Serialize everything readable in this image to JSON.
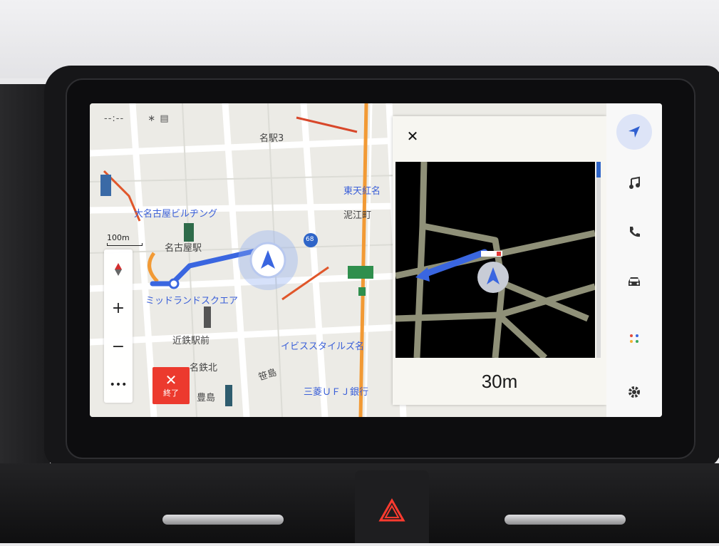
{
  "status": {
    "time": "--:--",
    "indicators": "∗ ▤"
  },
  "map": {
    "scale_label": "100m",
    "labels": {
      "meieki3": "名駅3",
      "dai_nagoya_bldg": "大名古屋ビルヂング",
      "meitetsu": "名古屋駅",
      "midland_square": "ミッドランドスクエア",
      "kintetsu": "近鉄駅前",
      "meieki_kita": "名鉄北",
      "ibis_styles": "イビススタイルズ名",
      "mufg": "三菱ＵＦＪ銀行",
      "toyoda": "豊島",
      "sasashima": "笹島",
      "higashi_meika": "東天紅名",
      "shinkawabashi": "泥江町",
      "route_68": "68"
    }
  },
  "zoom_panel": {
    "zoom_in": "+",
    "zoom_out": "−",
    "more": "•••"
  },
  "end_button": {
    "icon": "✕",
    "label": "終了"
  },
  "intersection_popup": {
    "close": "✕",
    "distance": "30m"
  },
  "rail": {
    "items": [
      "navigation-arrow-icon",
      "music-note-icon",
      "phone-icon",
      "car-icon",
      "apps-grid-icon",
      "settings-gear-icon"
    ]
  },
  "colors": {
    "accent_blue": "#3a66e0",
    "end_red": "#ec3a2e",
    "rail_active": "#dde4f7"
  }
}
